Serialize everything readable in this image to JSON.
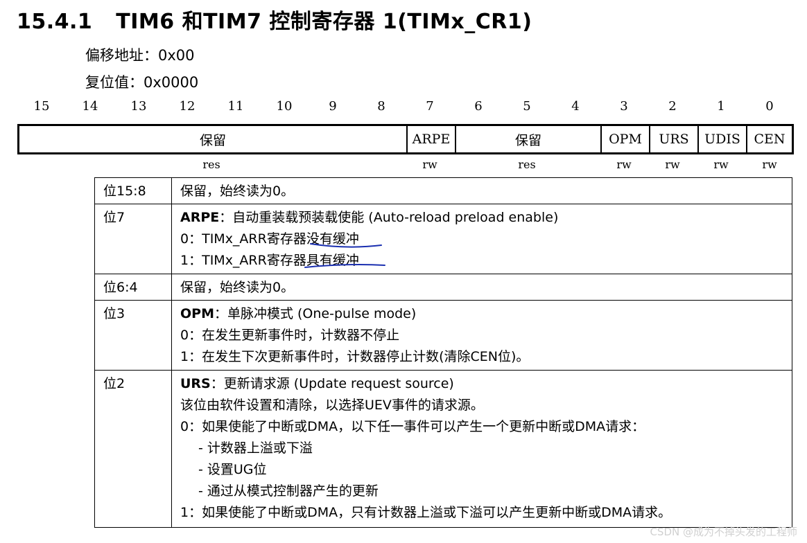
{
  "title": {
    "number": "15.4.1",
    "text": "TIM6 和TIM7 控制寄存器 1(TIMx_CR1)"
  },
  "offset": "偏移地址：0x00",
  "reset": "复位值：0x0000",
  "bit_numbers": [
    "15",
    "14",
    "13",
    "12",
    "11",
    "10",
    "9",
    "8",
    "7",
    "6",
    "5",
    "4",
    "3",
    "2",
    "1",
    "0"
  ],
  "fields": [
    "保留",
    "ARPE",
    "保留",
    "OPM",
    "URS",
    "UDIS",
    "CEN"
  ],
  "access": [
    "res",
    "rw",
    "res",
    "rw",
    "rw",
    "rw",
    "rw"
  ],
  "descriptions": [
    {
      "bit": "位15:8",
      "lines": [
        "保留，始终读为0。"
      ]
    },
    {
      "bit": "位7",
      "name": "ARPE",
      "title": "：自动重装载预装载使能 (Auto-reload preload enable)",
      "lines": [
        "0：TIMx_ARR寄存器没有缓冲",
        "1：TIMx_ARR寄存器具有缓冲"
      ]
    },
    {
      "bit": "位6:4",
      "lines": [
        "保留，始终读为0。"
      ]
    },
    {
      "bit": "位3",
      "name": "OPM",
      "title": "：单脉冲模式 (One-pulse mode)",
      "lines": [
        "0：在发生更新事件时，计数器不停止",
        "1：在发生下次更新事件时，计数器停止计数(清除CEN位)。"
      ]
    },
    {
      "bit": "位2",
      "name": "URS",
      "title": "：更新请求源 (Update request source)",
      "lines": [
        "该位由软件设置和清除，以选择UEV事件的请求源。",
        "0：如果使能了中断或DMA，以下任一事件可以产生一个更新中断或DMA请求：",
        "- 计数器上溢或下溢",
        "- 设置UG位",
        "- 通过从模式控制器产生的更新",
        "1：如果使能了中断或DMA，只有计数器上溢或下溢可以产生更新中断或DMA请求。"
      ]
    }
  ],
  "watermark": "CSDN @成为不掉头发的工程师",
  "colors": {
    "annotation_ink": "#1a2fb0"
  }
}
